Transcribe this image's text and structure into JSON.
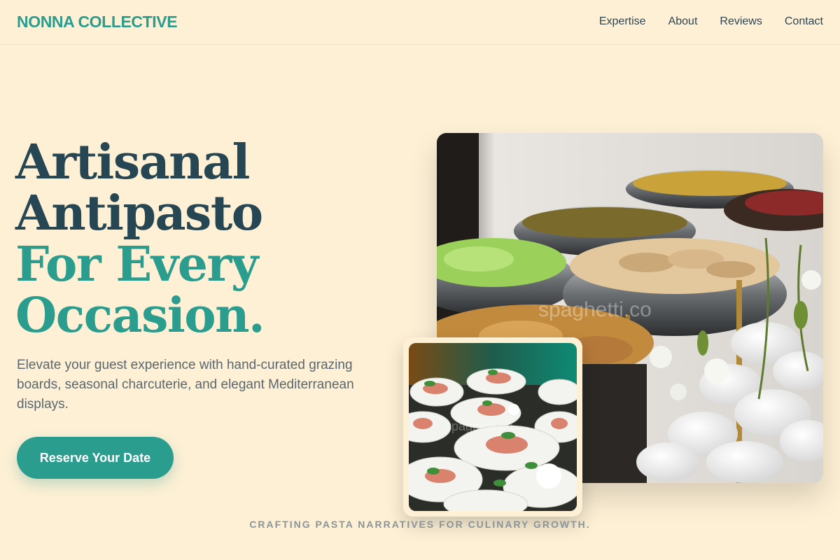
{
  "brand": {
    "name": "NONNA COLLECTIVE"
  },
  "nav": {
    "items": [
      {
        "label": "Expertise"
      },
      {
        "label": "About"
      },
      {
        "label": "Reviews"
      },
      {
        "label": "Contact"
      }
    ]
  },
  "hero": {
    "title_line1": "Artisanal",
    "title_line2": "Antipasto",
    "title_line3": "For Every",
    "title_line4": "Occasion.",
    "description": "Elevate your guest experience with hand-curated grazing boards, seasonal charcuterie, and elegant Mediterranean displays.",
    "cta_label": "Reserve Your Date"
  },
  "images": {
    "main_watermark": "spaghetti.co",
    "sub_watermark": "spaghetti.co"
  },
  "tagline": "CRAFTING PASTA NARRATIVES FOR CULINARY GROWTH.",
  "colors": {
    "background": "#fdf0d5",
    "accent": "#2a9d8f",
    "dark": "#264653",
    "text": "#5a6770"
  }
}
